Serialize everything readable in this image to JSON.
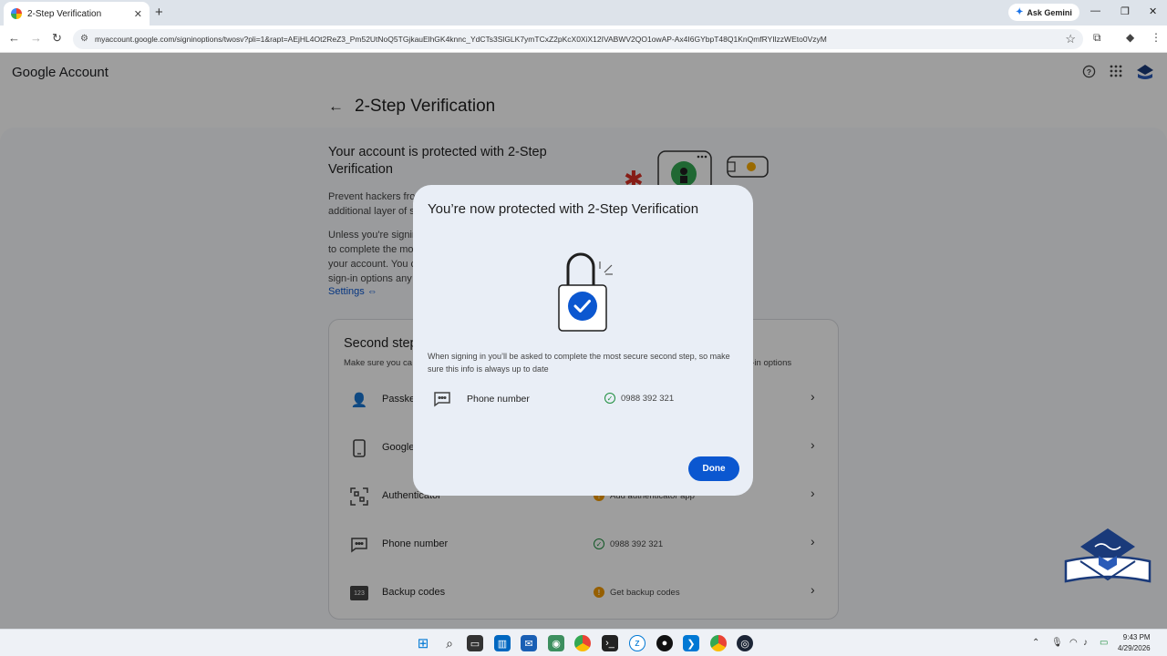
{
  "browser": {
    "tab_title": "2-Step Verification",
    "tab_close": "✕",
    "new_tab": "+",
    "ask_gemini": "Ask Gemini",
    "url": "myaccount.google.com/signinoptions/twosv?pli=1&rapt=AEjHL4Ot2ReZ3_Pm52UtNoQ5TGjkauElhGK4knnc_YdCTs3SlGLK7ymTCxZ2pKcX0XiX12IVABWV2QO1owAP-Ax4I6GYbpT48Q1KnQmfRYIlzzWEto0VzyM"
  },
  "header": {
    "brand": "Google Account",
    "help_icon": "help-icon",
    "apps_icon": "apps-grid-icon"
  },
  "page": {
    "back_icon": "←",
    "title": "2-Step Verification",
    "protected_heading": "Your account is protected with 2-Step Verification",
    "para1_line1": "Prevent hackers fro",
    "para1_line2": "additional layer of s",
    "para2_line1": "Unless you're signir",
    "para2_line2": "to complete the mo",
    "para2_line3": "your account. You c",
    "para2_line4": "sign-in options any",
    "settings_link": "Settings"
  },
  "second_steps": {
    "title": "Second step",
    "subtitle": "Make sure you ca",
    "subtitle_right": "n-in options",
    "rows": [
      {
        "label": "Passke",
        "status": "",
        "icon": "passkey-icon"
      },
      {
        "label": "Google",
        "status": "",
        "icon": "phone-device-icon"
      },
      {
        "label": "Authenticator",
        "status": "Add authenticator app",
        "icon": "qr-scan-icon"
      },
      {
        "label": "Phone number",
        "status": "0988 392 321",
        "icon": "message-icon"
      },
      {
        "label": "Backup codes",
        "status": "Get backup codes",
        "icon": "123-badge-icon",
        "badge": "123"
      }
    ]
  },
  "dialog": {
    "title": "You’re now protected with 2-Step Verification",
    "description": "When signing in you’ll be asked to complete the most secure second step, so make sure this info is always up to date",
    "phone_label": "Phone number",
    "phone_value": "0988 392 321",
    "done_label": "Done"
  },
  "taskbar": {
    "time": "9:43 PM",
    "date": "4/29/2026"
  },
  "colors": {
    "accent": "#0b57d0",
    "success": "#1e8e3e",
    "warning": "#f29900",
    "dialog_bg": "#e9eef6"
  }
}
